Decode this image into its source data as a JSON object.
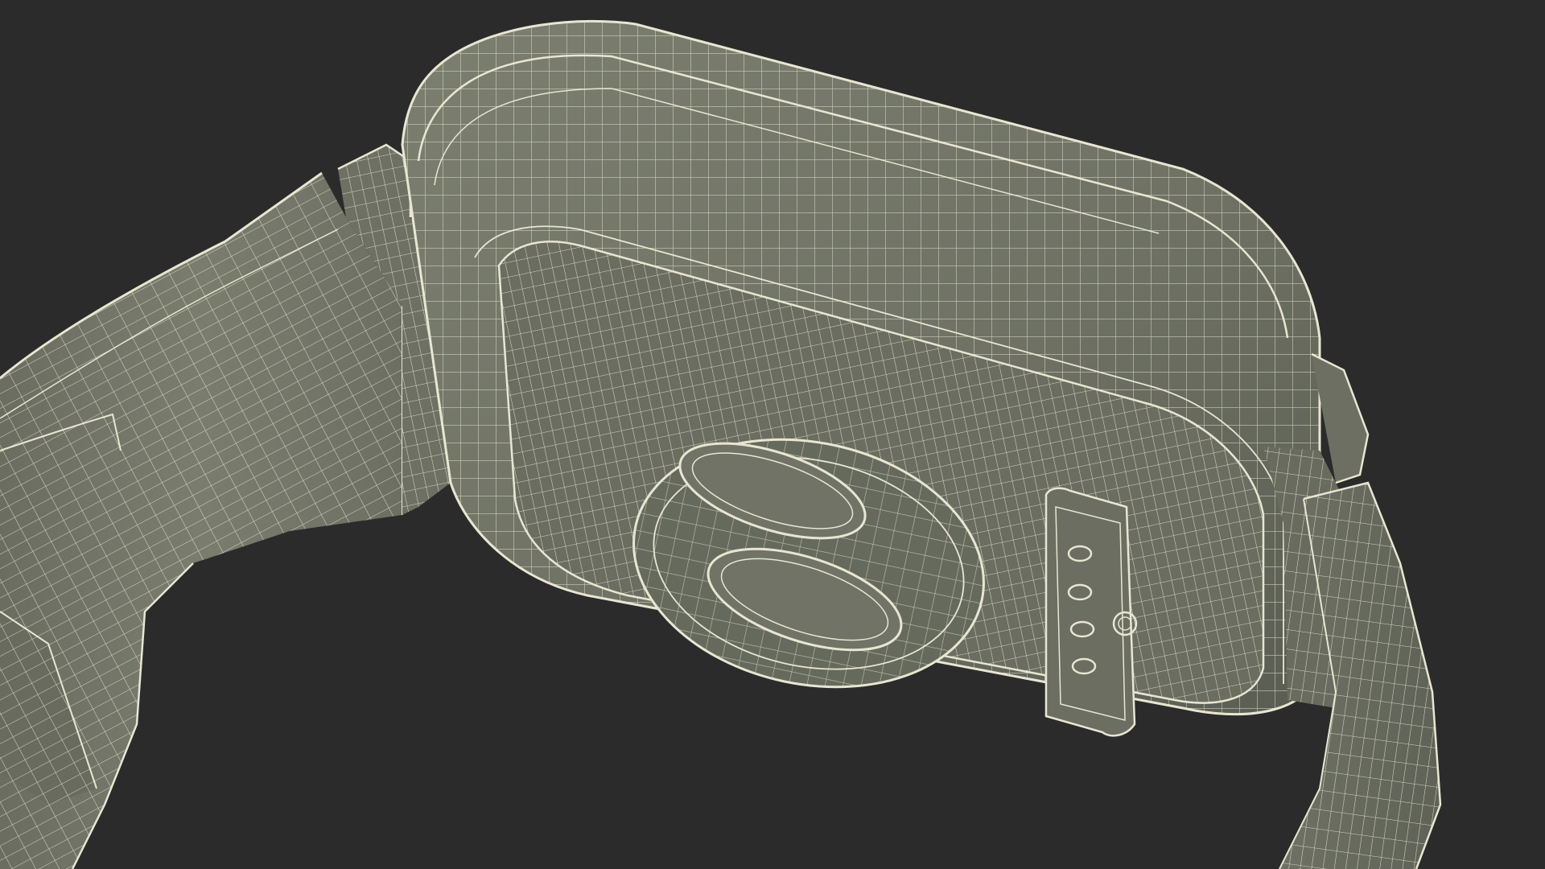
{
  "scene": {
    "subject": "smartwatch-back-wireframe",
    "background_color": "#2b2b2b",
    "surface_color": "#75786a",
    "surface_shadow_color": "#5d6054",
    "wire_color": "#e8e6d2"
  }
}
